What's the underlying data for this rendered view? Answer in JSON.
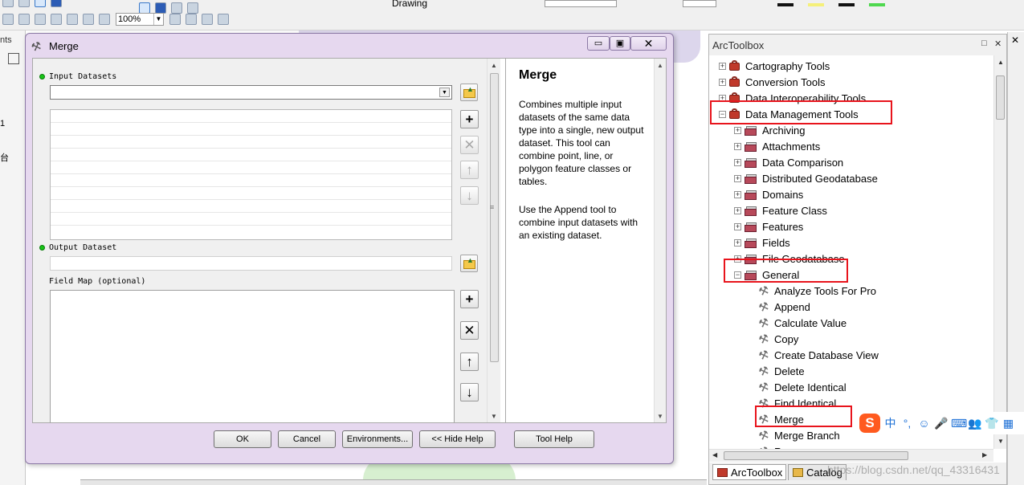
{
  "app": {
    "toolbar": {
      "zoom_value": "100%",
      "drawing_label": "Drawing"
    },
    "left_panel": {
      "partial_label": "nts",
      "char_1": "1",
      "char_2": "台"
    }
  },
  "merge_dialog": {
    "title": "Merge",
    "window_buttons": {
      "minimize": "▭",
      "maximize": "▣",
      "close": "✕"
    },
    "input_datasets_label": "Input Datasets",
    "input_datasets_value": "",
    "output_dataset_label": "Output Dataset",
    "output_dataset_value": "",
    "field_map_label": "Field Map (optional)",
    "side_buttons": {
      "add": "+",
      "remove": "✕",
      "up": "↑",
      "down": "↓"
    },
    "help": {
      "title": "Merge",
      "paragraph_1": "Combines multiple input datasets of the same data type into a single, new output dataset. This tool can combine point, line, or polygon feature classes or tables.",
      "paragraph_2": "Use the Append tool to combine input datasets with an existing dataset."
    },
    "buttons": {
      "ok": "OK",
      "cancel": "Cancel",
      "environments": "Environments...",
      "hide_help": "<< Hide Help",
      "tool_help": "Tool Help"
    }
  },
  "arctoolbox": {
    "title": "ArcToolbox",
    "header_buttons": {
      "restore": "□",
      "close": "✕"
    },
    "tree": [
      {
        "label": "Cartography Tools",
        "type": "toolbox",
        "expanded": false,
        "level": 0
      },
      {
        "label": "Conversion Tools",
        "type": "toolbox",
        "expanded": false,
        "level": 0
      },
      {
        "label": "Data Interoperability Tools",
        "type": "toolbox",
        "expanded": false,
        "level": 0
      },
      {
        "label": "Data Management Tools",
        "type": "toolbox",
        "expanded": true,
        "level": 0
      },
      {
        "label": "Archiving",
        "type": "toolset",
        "expanded": false,
        "level": 1
      },
      {
        "label": "Attachments",
        "type": "toolset",
        "expanded": false,
        "level": 1
      },
      {
        "label": "Data Comparison",
        "type": "toolset",
        "expanded": false,
        "level": 1
      },
      {
        "label": "Distributed Geodatabase",
        "type": "toolset",
        "expanded": false,
        "level": 1
      },
      {
        "label": "Domains",
        "type": "toolset",
        "expanded": false,
        "level": 1
      },
      {
        "label": "Feature Class",
        "type": "toolset",
        "expanded": false,
        "level": 1
      },
      {
        "label": "Features",
        "type": "toolset",
        "expanded": false,
        "level": 1
      },
      {
        "label": "Fields",
        "type": "toolset",
        "expanded": false,
        "level": 1
      },
      {
        "label": "File Geodatabase",
        "type": "toolset",
        "expanded": false,
        "level": 1
      },
      {
        "label": "General",
        "type": "toolset",
        "expanded": true,
        "level": 1
      },
      {
        "label": "Analyze Tools For Pro",
        "type": "tool",
        "level": 2
      },
      {
        "label": "Append",
        "type": "tool",
        "level": 2
      },
      {
        "label": "Calculate Value",
        "type": "tool",
        "level": 2
      },
      {
        "label": "Copy",
        "type": "tool",
        "level": 2
      },
      {
        "label": "Create Database View",
        "type": "tool",
        "level": 2
      },
      {
        "label": "Delete",
        "type": "tool",
        "level": 2
      },
      {
        "label": "Delete Identical",
        "type": "tool",
        "level": 2
      },
      {
        "label": "Find Identical",
        "type": "tool",
        "level": 2
      },
      {
        "label": "Merge",
        "type": "tool",
        "level": 2
      },
      {
        "label": "Merge Branch",
        "type": "tool",
        "level": 2
      },
      {
        "label": "Rename",
        "type": "tool",
        "level": 2
      }
    ],
    "tabs": [
      {
        "label": "ArcToolbox",
        "active": true
      },
      {
        "label": "Catalog",
        "active": false
      }
    ]
  },
  "ime_bar": {
    "logo": "S",
    "glyphs": [
      "中",
      "°,",
      "☺",
      "🎤",
      "⌨",
      "👥",
      "👕",
      "▦"
    ]
  },
  "watermark": "https://blog.csdn.net/qq_43316431",
  "colors": {
    "highlight": "#e8141c",
    "dialog_frame": "#e6d8ef",
    "required_dot": "#18c418",
    "toolbox_red": "#c0392b"
  }
}
